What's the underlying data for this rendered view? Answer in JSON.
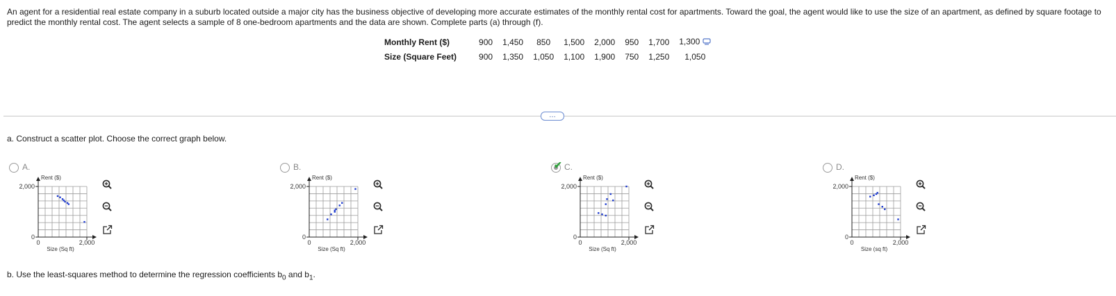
{
  "problem_text": "An agent for a residential real estate company in a suburb located outside a major city has the business objective of developing more accurate estimates of the monthly rental cost for apartments. Toward the goal, the agent would like to use the size of an apartment, as defined by square footage to predict the monthly rental cost. The agent selects a sample of 8 one-bedroom apartments and the data are shown. Complete parts (a) through (f).",
  "table": {
    "rent_header": "Monthly Rent ($)",
    "size_header": "Size (Square Feet)",
    "rent_values": [
      "900",
      "1,450",
      "850",
      "1,500",
      "2,000",
      "950",
      "1,700",
      "1,300"
    ],
    "size_values": [
      "900",
      "1,350",
      "1,050",
      "1,100",
      "1,900",
      "750",
      "1,250",
      "1,050"
    ]
  },
  "expand_label": "…",
  "part_a": "a. Construct a scatter plot. Choose the correct graph below.",
  "part_b_prefix": "b. Use the least-squares method to determine the regression coefficients b",
  "part_b_sub0": "0",
  "part_b_and": " and b",
  "part_b_sub1": "1",
  "part_b_suffix": ".",
  "options": [
    {
      "letter": "A.",
      "checked": false,
      "ylabel": "Rent ($)",
      "xlabel": "Size (Sq ft)",
      "ytick_top": "2,000",
      "ytick_bottom": "0",
      "xtick_left": "0",
      "xtick_right": "2,000",
      "points": [
        [
          800,
          1620
        ],
        [
          900,
          1570
        ],
        [
          1000,
          1500
        ],
        [
          1050,
          1450
        ],
        [
          1100,
          1400
        ],
        [
          1200,
          1350
        ],
        [
          1250,
          1300
        ],
        [
          1900,
          600
        ]
      ]
    },
    {
      "letter": "B.",
      "checked": false,
      "ylabel": "Rent ($)",
      "xlabel": "Size (Sq ft)",
      "ytick_top": "2,000",
      "ytick_bottom": "0",
      "xtick_left": "0",
      "xtick_right": "2,000",
      "points": [
        [
          750,
          700
        ],
        [
          900,
          900
        ],
        [
          1050,
          1000
        ],
        [
          1050,
          1050
        ],
        [
          1100,
          1100
        ],
        [
          1250,
          1250
        ],
        [
          1350,
          1350
        ],
        [
          1900,
          1900
        ]
      ]
    },
    {
      "letter": "C.",
      "checked": true,
      "ylabel": "Rent ($)",
      "xlabel": "Size (Sq ft)",
      "ytick_top": "2,000",
      "ytick_bottom": "0",
      "xtick_left": "0",
      "xtick_right": "2,000",
      "points": [
        [
          900,
          900
        ],
        [
          1350,
          1450
        ],
        [
          1050,
          850
        ],
        [
          1100,
          1500
        ],
        [
          1900,
          2000
        ],
        [
          750,
          950
        ],
        [
          1250,
          1700
        ],
        [
          1050,
          1300
        ]
      ]
    },
    {
      "letter": "D.",
      "checked": false,
      "ylabel": "Rent ($)",
      "xlabel": "Size (sq ft)",
      "ytick_top": "2,000",
      "ytick_bottom": "0",
      "xtick_left": "0",
      "xtick_right": "2,000",
      "points": [
        [
          750,
          1600
        ],
        [
          900,
          1650
        ],
        [
          1000,
          1700
        ],
        [
          1050,
          1750
        ],
        [
          1100,
          1300
        ],
        [
          1250,
          1200
        ],
        [
          1350,
          1100
        ],
        [
          1900,
          700
        ]
      ]
    }
  ],
  "icons": {
    "zoom_in": "zoom-in-icon",
    "zoom_out": "zoom-out-icon",
    "popout": "popout-icon",
    "copy": "copy-icon"
  },
  "colors": {
    "point": "#1f3ccf",
    "check": "#2e9e3a",
    "link": "#365aa8"
  }
}
